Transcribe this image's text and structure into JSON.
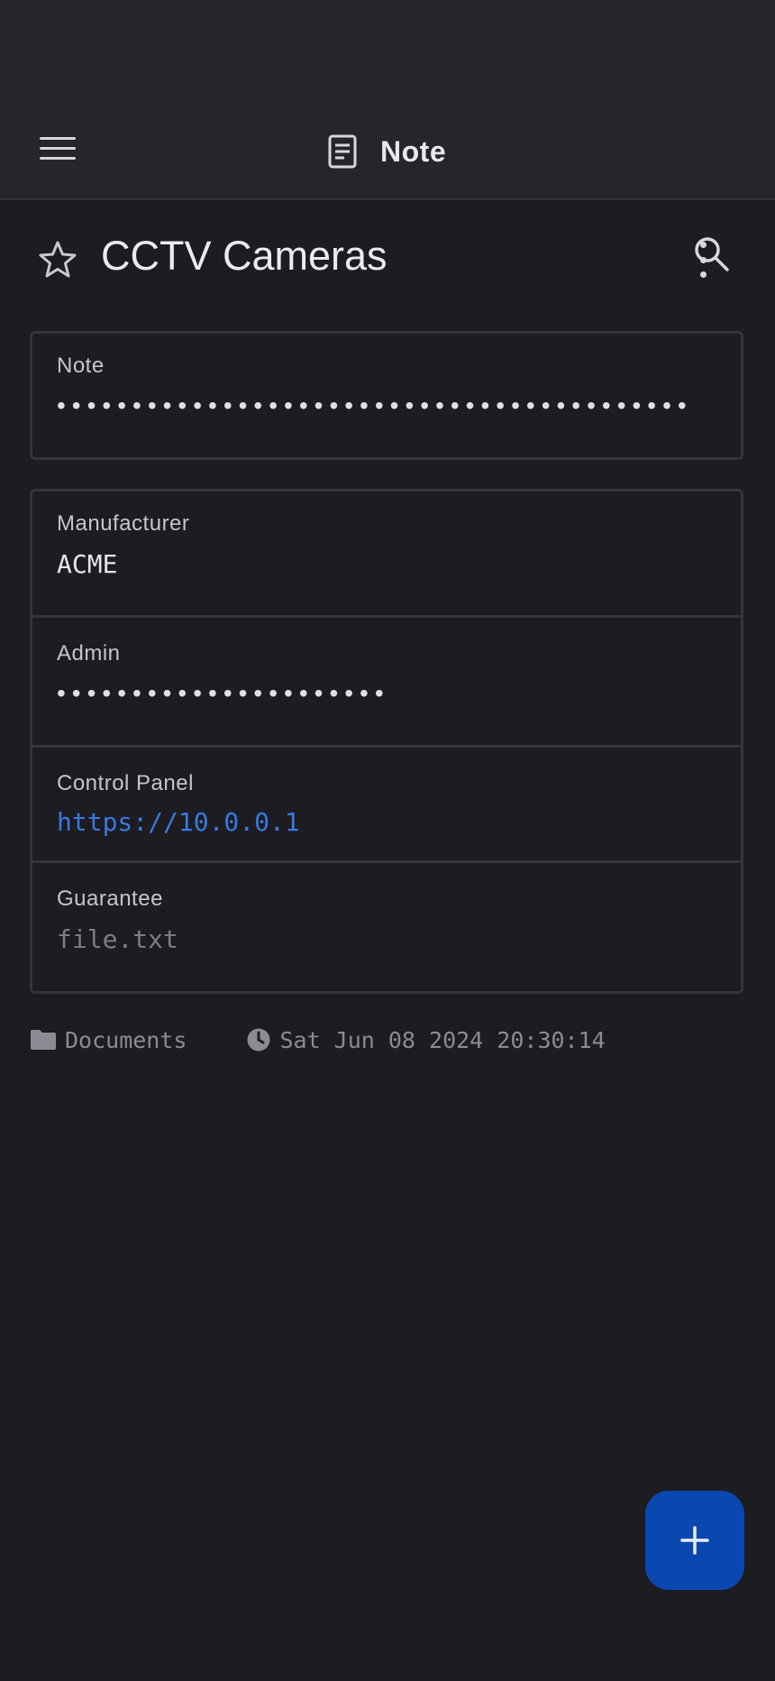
{
  "appbar": {
    "title": "Note"
  },
  "note": {
    "title": "CCTV Cameras",
    "note_field": {
      "label": "Note",
      "value": "••••••••••••••••••••••••••••••••••••••••••"
    },
    "fields": [
      {
        "label": "Manufacturer",
        "value": "ACME"
      },
      {
        "label": "Admin",
        "value": "••••••••••••••••••••••"
      },
      {
        "label": "Control Panel",
        "value": "https://10.0.0.1"
      },
      {
        "label": "Guarantee",
        "value": "file.txt"
      }
    ]
  },
  "meta": {
    "folder": "Documents",
    "modified": "Sat Jun 08 2024 20:30:14"
  },
  "colors": {
    "accent": "#0a47b0",
    "link": "#3a78e0",
    "background": "#1c1c21"
  }
}
